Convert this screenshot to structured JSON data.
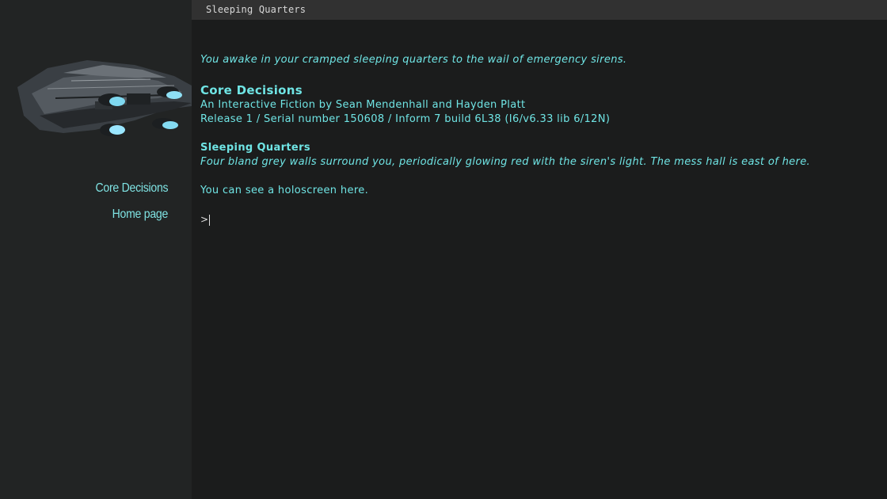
{
  "sidebar": {
    "links": [
      {
        "label": "Core Decisions"
      },
      {
        "label": "Home page"
      }
    ]
  },
  "status_bar": {
    "location": "Sleeping Quarters"
  },
  "transcript": {
    "intro": "You awake in your cramped sleeping quarters to the wail of emergency sirens.",
    "game_title": "Core Decisions",
    "byline": "An Interactive Fiction by Sean Mendenhall and Hayden Platt",
    "release": "Release 1 / Serial number 150608 / Inform 7 build 6L38 (I6/v6.33 lib 6/12N)",
    "room_name": "Sleeping Quarters",
    "room_description": "Four bland grey walls surround you, periodically glowing red with the siren's light. The mess hall is east of here.",
    "objects": "You can see a holoscreen here."
  },
  "command_line": {
    "prompt": ">",
    "value": ""
  },
  "colors": {
    "text": "#6fe4e4",
    "background": "#1b1c1c",
    "sidebar": "#222424",
    "topbar": "#313131"
  }
}
